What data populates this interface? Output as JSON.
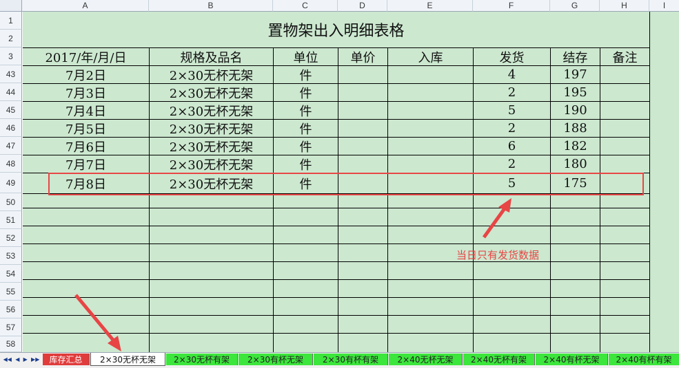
{
  "columns": [
    "A",
    "B",
    "C",
    "D",
    "E",
    "F",
    "G",
    "H",
    "I"
  ],
  "row_numbers": [
    "1",
    "2",
    "3",
    "43",
    "44",
    "45",
    "46",
    "47",
    "48",
    "49",
    "50",
    "51",
    "52",
    "53",
    "54",
    "55",
    "56",
    "57",
    "58"
  ],
  "title": "置物架出入明细表格",
  "headers": {
    "date": "2017/年/月/日",
    "spec": "规格及品名",
    "unit": "单位",
    "price": "单价",
    "in": "入库",
    "out": "发货",
    "stock": "结存",
    "note": "备注"
  },
  "rows": [
    {
      "date": "7月2日",
      "spec": "2×30无杯无架",
      "unit": "件",
      "out": "4",
      "stock": "197"
    },
    {
      "date": "7月3日",
      "spec": "2×30无杯无架",
      "unit": "件",
      "out": "2",
      "stock": "195"
    },
    {
      "date": "7月4日",
      "spec": "2×30无杯无架",
      "unit": "件",
      "out": "5",
      "stock": "190"
    },
    {
      "date": "7月5日",
      "spec": "2×30无杯无架",
      "unit": "件",
      "out": "2",
      "stock": "188"
    },
    {
      "date": "7月6日",
      "spec": "2×30无杯无架",
      "unit": "件",
      "out": "6",
      "stock": "182"
    },
    {
      "date": "7月7日",
      "spec": "2×30无杯无架",
      "unit": "件",
      "out": "2",
      "stock": "180"
    },
    {
      "date": "7月8日",
      "spec": "2×30无杯无架",
      "unit": "件",
      "out": "5",
      "stock": "175"
    }
  ],
  "annotation": "当日只有发货数据",
  "tab_nav": [
    "◀◀",
    "◀",
    "▶",
    "▶▶"
  ],
  "sheet_tabs": [
    "库存汇总",
    "2×30无杯无架",
    "2×30无杯有架",
    "2×30有杯无架",
    "2×30有杯有架",
    "2×40无杯无架",
    "2×40无杯有架",
    "2×40有杯无架",
    "2×40有杯有架"
  ],
  "colors": {
    "sheet_bg": "#cce8cf",
    "highlight": "#e84545",
    "tab_green": "#3ce63c",
    "tab_red": "#e03c3c"
  }
}
